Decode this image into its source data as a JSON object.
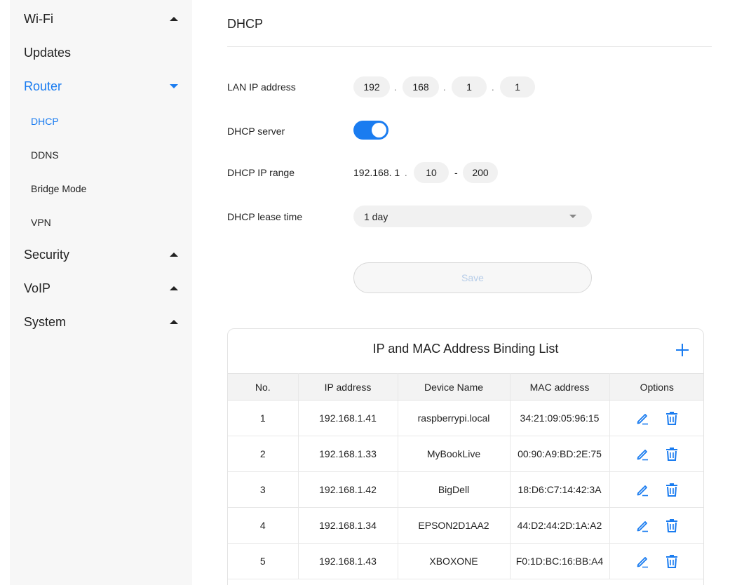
{
  "sidebar": {
    "items": [
      {
        "label": "Wi-Fi"
      },
      {
        "label": "Updates"
      },
      {
        "label": "Router"
      },
      {
        "label": "Security"
      },
      {
        "label": "VoIP"
      },
      {
        "label": "System"
      }
    ],
    "router_sub": [
      {
        "label": "DHCP"
      },
      {
        "label": "DDNS"
      },
      {
        "label": "Bridge Mode"
      },
      {
        "label": "VPN"
      }
    ]
  },
  "page": {
    "title": "DHCP"
  },
  "form": {
    "lan_ip_label": "LAN IP address",
    "lan_ip": [
      "192",
      "168",
      "1",
      "1"
    ],
    "dhcp_server_label": "DHCP server",
    "dhcp_server_enabled": true,
    "dhcp_range_label": "DHCP IP range",
    "dhcp_range_prefix": "192.168. 1",
    "dhcp_range_start": "10",
    "dhcp_range_end": "200",
    "lease_label": "DHCP lease time",
    "lease_value": "1 day",
    "save_label": "Save"
  },
  "binding": {
    "title": "IP and MAC Address Binding List",
    "columns": [
      "No.",
      "IP address",
      "Device Name",
      "MAC address",
      "Options"
    ],
    "rows": [
      {
        "no": "1",
        "ip": "192.168.1.41",
        "name": "raspberrypi.local",
        "mac": "34:21:09:05:96:15"
      },
      {
        "no": "2",
        "ip": "192.168.1.33",
        "name": "MyBookLive",
        "mac": "00:90:A9:BD:2E:75"
      },
      {
        "no": "3",
        "ip": "192.168.1.42",
        "name": "BigDell",
        "mac": "18:D6:C7:14:42:3A"
      },
      {
        "no": "4",
        "ip": "192.168.1.34",
        "name": "EPSON2D1AA2",
        "mac": "44:D2:44:2D:1A:A2"
      },
      {
        "no": "5",
        "ip": "192.168.1.43",
        "name": "XBOXONE",
        "mac": "F0:1D:BC:16:BB:A4"
      }
    ]
  },
  "colors": {
    "accent": "#1a7cf0",
    "sidebar_bg": "#f7f7f7"
  },
  "icons": [
    "chevron-up-icon",
    "chevron-down-icon",
    "caret-down-icon",
    "plus-icon",
    "edit-icon",
    "delete-icon"
  ]
}
